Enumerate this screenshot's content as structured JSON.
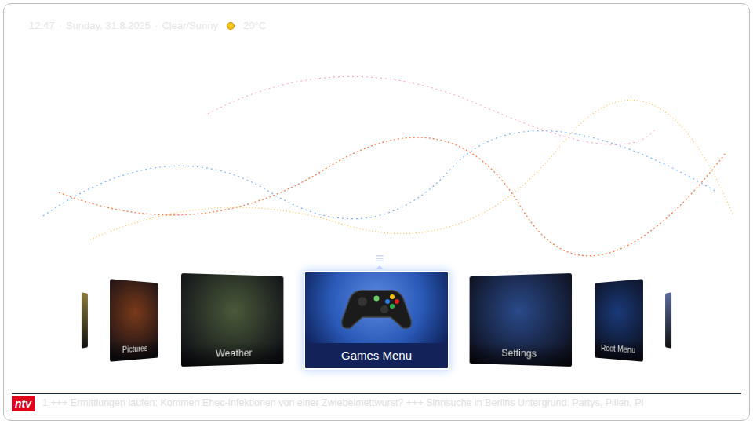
{
  "status_bar": {
    "time": "12:47",
    "separator": "·",
    "date": "Sunday, 31.8.2025",
    "weather": "Clear/Sunny",
    "temperature": "20°C"
  },
  "menu": {
    "indicator": "≡",
    "items": [
      {
        "label": "",
        "kind": "edge",
        "selected": false,
        "color": "#8a7a3a"
      },
      {
        "label": "Pictures",
        "kind": "tile",
        "selected": false,
        "color": "#7a3a1a"
      },
      {
        "label": "Weather",
        "kind": "tile",
        "selected": false,
        "color": "#4a5a3a"
      },
      {
        "label": "Games Menu",
        "kind": "tile",
        "selected": true,
        "color": "#2a5ab8"
      },
      {
        "label": "Settings",
        "kind": "tile",
        "selected": false,
        "color": "#2a4a8a"
      },
      {
        "label": "Root Menu",
        "kind": "tile",
        "selected": false,
        "color": "#1a3a7a"
      },
      {
        "label": "",
        "kind": "edge",
        "selected": false,
        "color": "#5a6a9a"
      }
    ]
  },
  "ticker": {
    "logo": "ntv",
    "text": "1 +++ Ermittlungen laufen: Kommen Ehec-Infektionen von einer Zwiebelmettwurst? +++ Sinnsuche in Berlins Untergrund: Partys, Pillen, Pl"
  }
}
